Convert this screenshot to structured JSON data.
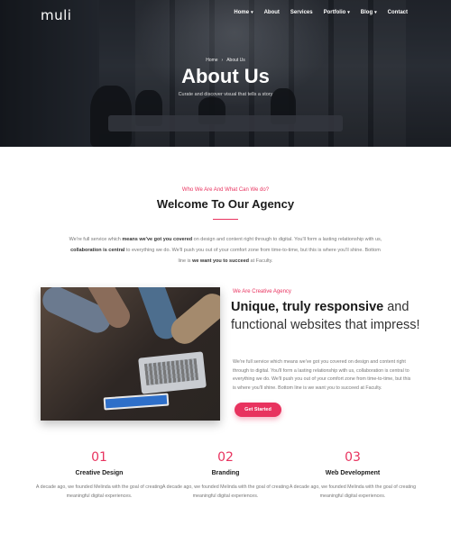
{
  "brand": {
    "logo": "muli",
    "accent": "#e8335f"
  },
  "nav": {
    "items": [
      {
        "label": "Home",
        "has_caret": true
      },
      {
        "label": "About",
        "has_caret": false
      },
      {
        "label": "Services",
        "has_caret": false
      },
      {
        "label": "Portfolio",
        "has_caret": true
      },
      {
        "label": "Blog",
        "has_caret": true
      },
      {
        "label": "Contact",
        "has_caret": false
      }
    ],
    "caret_glyph": "▾"
  },
  "hero": {
    "breadcrumb": {
      "home": "Home",
      "separator": "›",
      "current": "About Us"
    },
    "title": "About Us",
    "subtitle": "Curate and discover visual that tells a story"
  },
  "welcome": {
    "eyebrow": "Who We Are And What Can We do?",
    "title": "Welcome To Our Agency",
    "intro": {
      "p1": "We're full service which ",
      "b1": "means we've got you covered",
      "p2": " on design and content right through to digital. You'll form a lasting relationship with us, ",
      "b2": "collaboration is central",
      "p3": " to everything we do. We'll push you out of your comfort zone from time-to-time, but this is where you'll shine. Bottom line is ",
      "b3": "we want you to succeed",
      "p4": " at Faculty."
    }
  },
  "feature": {
    "eyebrow": "We Are Creative Agency",
    "title_bold": "Unique, truly responsive",
    "title_rest": " and functional websites that impress!",
    "text": "We're full service which means we've got you covered on design and content right through to digital. You'll form a lasting relationship with us, collaboration is central to everything we do. We'll push you out of your comfort zone from time-to-time, but this is where you'll shine. Bottom line is we want you to succeed at Faculty.",
    "button": "Get Started"
  },
  "services": [
    {
      "num": "01",
      "name": "Creative Design",
      "desc": "A decade ago, we founded Melinda with the goal of creating meaningful digital experiences."
    },
    {
      "num": "02",
      "name": "Branding",
      "desc": "A decade ago, we founded Melinda with the goal of creating meaningful digital experiences."
    },
    {
      "num": "03",
      "name": "Web Development",
      "desc": "A decade ago, we founded Melinda with the goal of creating meaningful digital experiences."
    }
  ]
}
